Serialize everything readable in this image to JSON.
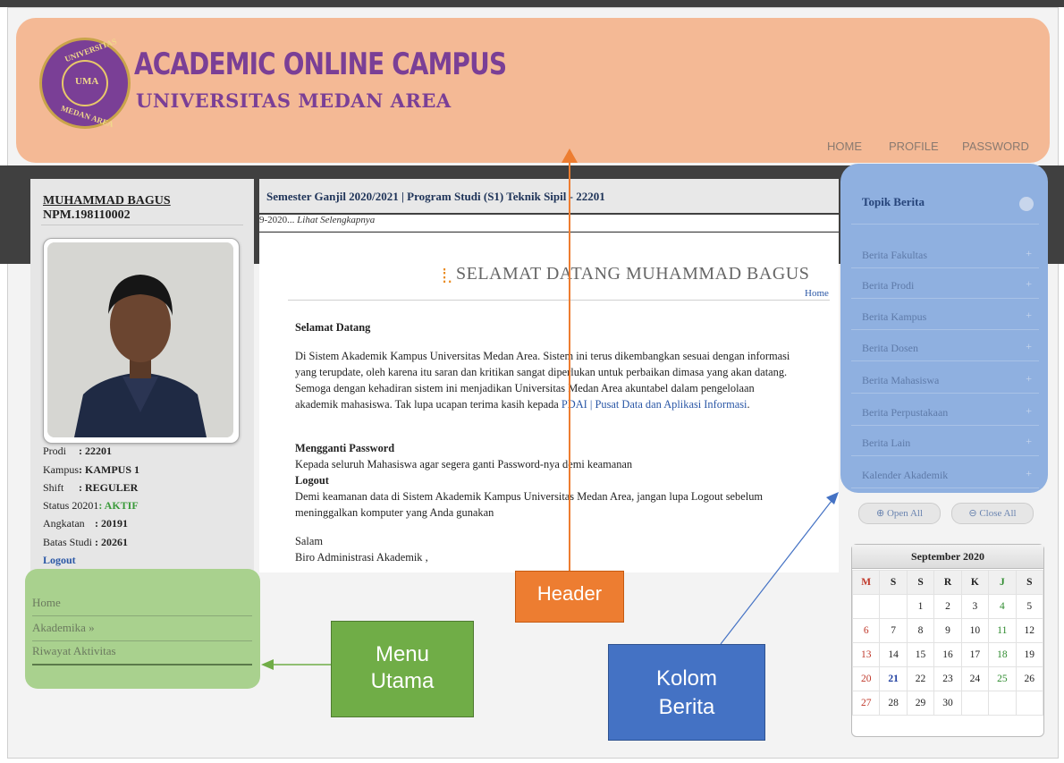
{
  "header": {
    "logo_text_top": "UNIVERSITAS",
    "logo_text_bottom": "MEDAN AREA",
    "logo_center": "UMA",
    "title": "ACADEMIC ONLINE CAMPUS",
    "subtitle": "UNIVERSITAS MEDAN AREA",
    "nav": [
      "HOME",
      "PROFILE",
      "PASSWORD"
    ]
  },
  "student": {
    "name": "MUHAMMAD BAGUS",
    "npm": "NPM.198110002",
    "fields": [
      {
        "label": "Prodi",
        "value": ": 22201"
      },
      {
        "label": "Kampus",
        "value": ": KAMPUS 1"
      },
      {
        "label": "Shift",
        "value": ": REGULER"
      },
      {
        "label": "Status 20201",
        "value": ": AKTIF"
      },
      {
        "label": "Angkatan",
        "value": ": 20191"
      },
      {
        "label": "Batas Studi",
        "value": ": 20261"
      }
    ],
    "logout": "Logout"
  },
  "menu": [
    "Home",
    "Akademika »",
    "Riwayat Aktivitas"
  ],
  "center": {
    "semester": "Semester Ganjil 2020/2021 | Program Studi (S1) Teknik Sipil - 22201",
    "marquee": "9-2020... ",
    "marquee_link": "Lihat Selengkapnya",
    "welcome": "SELAMAT DATANG MUHAMMAD BAGUS",
    "crumb": "Home",
    "h_welcome": "Selamat Datang",
    "p_welcome": "Di Sistem Akademik Kampus Universitas Medan Area. Sistem ini terus dikembangkan sesuai dengan informasi yang terupdate, oleh karena itu saran dan kritikan sangat diperlukan untuk perbaikan dimasa yang akan datang. Semoga dengan kehadiran sistem ini menjadikan Universitas Medan Area akuntabel dalam pengelolaan akademik mahasiswa. Tak lupa ucapan terima kasih kepada ",
    "pdai_link": "PDAI | Pusat Data dan Aplikasi Informasi",
    "p_welcome_end": ".",
    "h_password": "Mengganti Password",
    "p_password": "Kepada seluruh Mahasiswa agar segera ganti Password-nya demi keamanan",
    "h_logout": "Logout",
    "p_logout": "Demi keamanan data di Sistem Akademik Kampus Universitas Medan Area, jangan lupa Logout sebelum meninggalkan komputer yang Anda gunakan",
    "salam": "Salam",
    "signature": "Biro Administrasi Akademik ,"
  },
  "news": {
    "title": "Topik Berita",
    "items": [
      "Berita Fakultas",
      "Berita Prodi",
      "Berita Kampus",
      "Berita Dosen",
      "Berita Mahasiswa",
      "Berita Perpustakaan",
      "Berita Lain",
      "Kalender Akademik"
    ],
    "open_all": "Open All",
    "close_all": "Close All"
  },
  "calendar": {
    "month": "September 2020",
    "days": [
      "M",
      "S",
      "S",
      "R",
      "K",
      "J",
      "S"
    ],
    "weeks": [
      [
        "",
        "",
        "1",
        "2",
        "3",
        "4",
        "5"
      ],
      [
        "6",
        "7",
        "8",
        "9",
        "10",
        "11",
        "12"
      ],
      [
        "13",
        "14",
        "15",
        "16",
        "17",
        "18",
        "19"
      ],
      [
        "20",
        "21",
        "22",
        "23",
        "24",
        "25",
        "26"
      ],
      [
        "27",
        "28",
        "29",
        "30",
        "",
        "",
        ""
      ]
    ],
    "today": "21"
  },
  "callouts": {
    "header": "Header",
    "menu": "Menu Utama",
    "news": "Kolom Berita"
  },
  "colors": {
    "header_overlay": "#f4b995",
    "menu_overlay": "#a9d18e",
    "news_overlay": "#8fb0e0",
    "header_callout": "#ed7d31",
    "menu_callout": "#70ad47",
    "news_callout": "#4472c4",
    "brand_purple": "#7a3f96"
  }
}
